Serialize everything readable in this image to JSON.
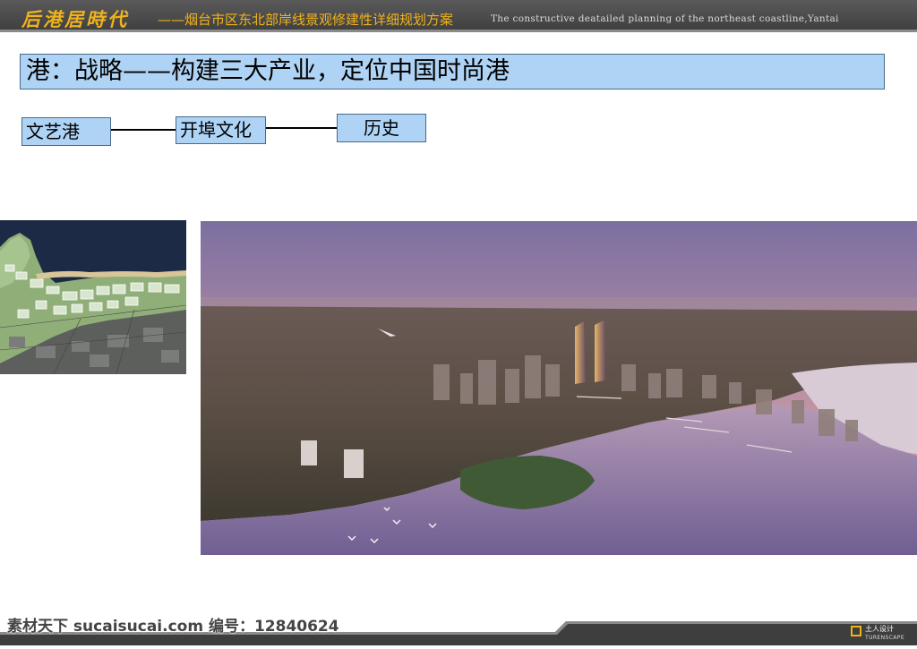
{
  "header": {
    "brand": "后港居時代",
    "subtitle_cn": "——烟台市区东北部岸线景观修建性详细规划方案",
    "subtitle_en": "The constructive deatailed planning of the northeast coastline,Yantai"
  },
  "headline": "港：战略——构建三大产业，定位中国时尚港",
  "flow": {
    "items": [
      "文艺港",
      "开埠文化",
      "历史"
    ]
  },
  "footer": {
    "watermark": "素材天下 sucaisucai.com  编号：12840624",
    "logo_cn": "土人设计",
    "logo_en": "TURENSCAPE"
  },
  "colors": {
    "banner": "#4a4a4a",
    "brand_gold": "#f0b21c",
    "box_fill": "#aed3f5"
  },
  "images": {
    "map": "site-plan-map",
    "aerial": "aerial-rendering-coastline"
  }
}
